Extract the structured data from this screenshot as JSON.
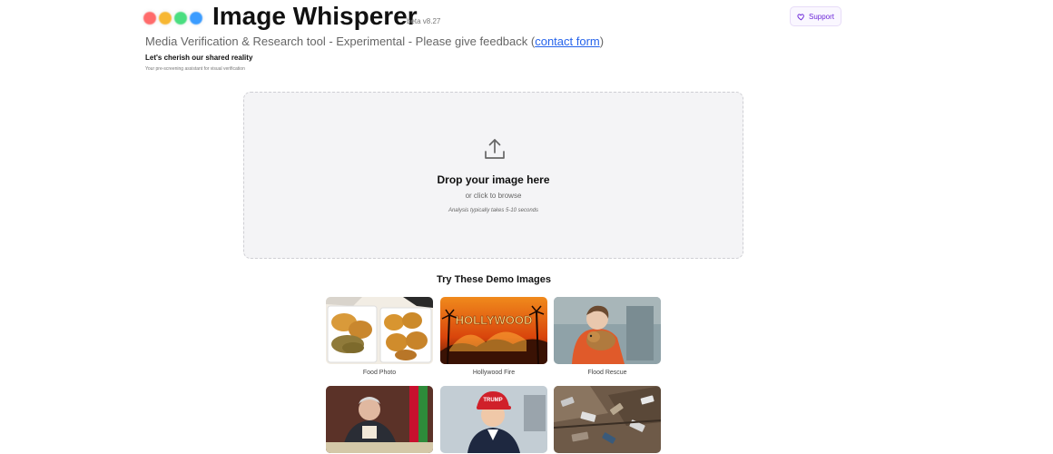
{
  "app": {
    "title": "Image Whisperer",
    "version": "beta v8.27",
    "subtitle_prefix": "Media Verification & Research tool - Experimental - Please give feedback (",
    "subtitle_link": "contact form",
    "subtitle_suffix": ")",
    "tagline": "Let's cherish our shared reality",
    "tagline_sub": "Your pre-screening assistant for visual verification",
    "logo_dot_colors": [
      "#ff6b6b",
      "#f7b733",
      "#4ade80",
      "#3b9cff"
    ]
  },
  "support_button": {
    "label": "Support",
    "icon": "heart-icon",
    "color": "#6d28d9"
  },
  "upload": {
    "icon": "upload-icon",
    "title": "Drop your image here",
    "subtitle": "or click to browse",
    "note": "Analysis typically takes 5-10 seconds"
  },
  "demo": {
    "title": "Try These Demo Images",
    "images": [
      {
        "caption": "Food Photo"
      },
      {
        "caption": "Hollywood Fire"
      },
      {
        "caption": "Flood Rescue"
      },
      {
        "caption": ""
      },
      {
        "caption": ""
      },
      {
        "caption": ""
      }
    ],
    "hollywood_sign_text": "HOLLYWOOD",
    "cap_text": "TRUMP"
  }
}
